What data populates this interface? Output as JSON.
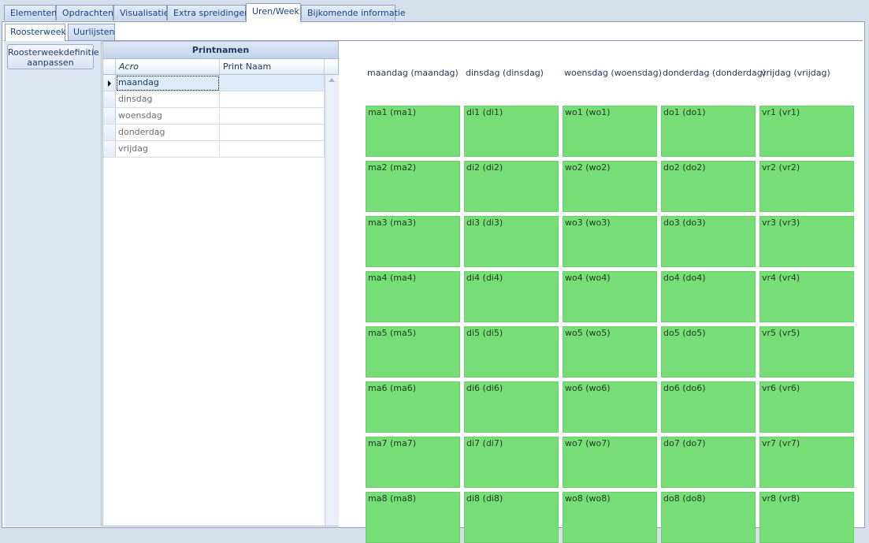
{
  "top_tabs": [
    "Elementen",
    "Opdrachten",
    "Visualisatie",
    "Extra spreidingen",
    "Uren/Week",
    "Bijkomende informatie"
  ],
  "active_top_tab": "Uren/Week",
  "sub_tabs": [
    "Roosterweek",
    "Uurlijsten"
  ],
  "active_sub_tab": "Roosterweek",
  "left_button_label": "Roosterweekdefinitie aanpassen",
  "grid": {
    "caption": "Printnamen",
    "columns": [
      "Acro",
      "Print Naam"
    ],
    "rows": [
      {
        "acro": "maandag",
        "print_naam": ""
      },
      {
        "acro": "dinsdag",
        "print_naam": ""
      },
      {
        "acro": "woensdag",
        "print_naam": ""
      },
      {
        "acro": "donderdag",
        "print_naam": ""
      },
      {
        "acro": "vrijdag",
        "print_naam": ""
      }
    ],
    "selected_row": 0
  },
  "schedule": {
    "day_headers": [
      "maandag (maandag)",
      "dinsdag (dinsdag)",
      "woensdag (woensdag)",
      "donderdag (donderdag)",
      "vrijdag (vrijdag)"
    ],
    "slots": [
      [
        "ma1 (ma1)",
        "di1 (di1)",
        "wo1 (wo1)",
        "do1 (do1)",
        "vr1 (vr1)"
      ],
      [
        "ma2 (ma2)",
        "di2 (di2)",
        "wo2 (wo2)",
        "do2 (do2)",
        "vr2 (vr2)"
      ],
      [
        "ma3 (ma3)",
        "di3 (di3)",
        "wo3 (wo3)",
        "do3 (do3)",
        "vr3 (vr3)"
      ],
      [
        "ma4 (ma4)",
        "di4 (di4)",
        "wo4 (wo4)",
        "do4 (do4)",
        "vr4 (vr4)"
      ],
      [
        "ma5 (ma5)",
        "di5 (di5)",
        "wo5 (wo5)",
        "do5 (do5)",
        "vr5 (vr5)"
      ],
      [
        "ma6 (ma6)",
        "di6 (di6)",
        "wo6 (wo6)",
        "do6 (do6)",
        "vr6 (vr6)"
      ],
      [
        "ma7 (ma7)",
        "di7 (di7)",
        "wo7 (wo7)",
        "do7 (do7)",
        "vr7 (vr7)"
      ],
      [
        "ma8 (ma8)",
        "di8 (di8)",
        "wo8 (wo8)",
        "do8 (do8)",
        "vr8 (vr8)"
      ]
    ],
    "slot_color": "#77dd77"
  }
}
